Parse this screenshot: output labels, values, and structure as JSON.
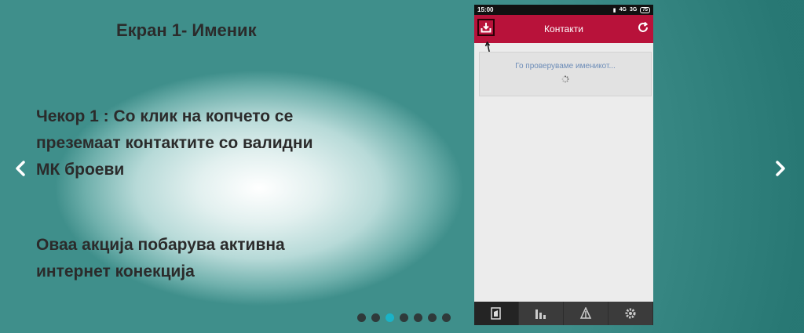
{
  "slide": {
    "title": "Екран 1- Именик",
    "step_line1": "Чекор 1 : Со клик на копчето се",
    "step_line2": "преземаат контактите со валидни",
    "step_line3": "МК броеви",
    "note_line1": "Оваа акција побарува активна",
    "note_line2": "интернет конекција"
  },
  "nav": {
    "prev_icon": "chevron-left-icon",
    "next_icon": "chevron-right-icon",
    "dots_total": 7,
    "active_dot": 2
  },
  "phone": {
    "status": {
      "time": "15:00",
      "network": "4G",
      "network2": "3G",
      "battery": "75"
    },
    "appbar": {
      "title": "Контакти",
      "left_icon": "download-contacts-icon",
      "right_icon": "refresh-icon"
    },
    "loading_text": "Го проверуваме именикот...",
    "tabs": [
      {
        "icon": "contacts-icon"
      },
      {
        "icon": "stats-icon"
      },
      {
        "icon": "notification-icon"
      },
      {
        "icon": "settings-icon"
      }
    ]
  },
  "colors": {
    "appbar": "#b8123a",
    "active_dot": "#1ab3c7",
    "loading_text": "#6d8db8"
  }
}
